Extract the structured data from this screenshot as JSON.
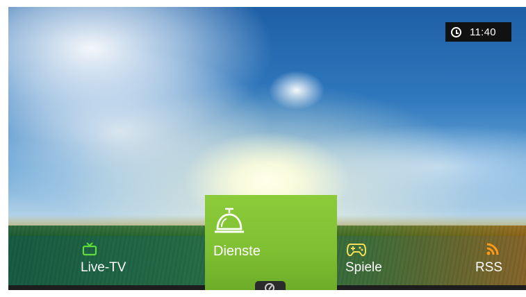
{
  "status": {
    "clock_icon": "clock-icon",
    "time": "11:40"
  },
  "menu": {
    "items": [
      {
        "id": "livetv",
        "label": "Live-TV",
        "icon": "tv-icon",
        "icon_color": "#5fdc3c",
        "selected": false
      },
      {
        "id": "dienste",
        "label": "Dienste",
        "icon": "service-bell-icon",
        "icon_color": "#ffffff",
        "selected": true
      },
      {
        "id": "spiele",
        "label": "Spiele",
        "icon": "gamepad-icon",
        "icon_color": "#f3e05a",
        "selected": false
      },
      {
        "id": "rss",
        "label": "RSS",
        "icon": "rss-icon",
        "icon_color": "#ff9a1a",
        "selected": false
      }
    ],
    "selected_tile_color": "#7fbf32"
  },
  "bottom": {
    "indicator_icon": "dashboard-gauge-icon"
  }
}
